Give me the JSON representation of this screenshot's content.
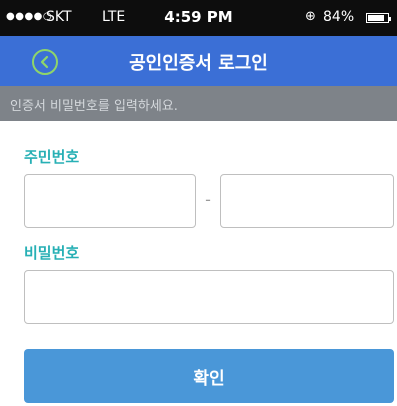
{
  "status_bar": {
    "signal": "●●●●○",
    "carrier": "SKT",
    "network": "LTE",
    "time": "4:59 PM",
    "battery_percent": "84%",
    "battery_level": 0.84
  },
  "header": {
    "back_icon": "chevron-left-circle-icon",
    "title": "공인인증서 로그인"
  },
  "notice": {
    "text": "인증서 비밀번호를 입력하세요."
  },
  "form": {
    "resident_label": "주민번호",
    "resident_front_value": "",
    "resident_back_value": "",
    "separator": "-",
    "password_label": "비밀번호",
    "password_value": ""
  },
  "actions": {
    "confirm_label": "확인"
  },
  "colors": {
    "nav_bar": "#3b6fd6",
    "back_icon_accent": "#8fd56a",
    "label_accent": "#27b0b5",
    "button": "#4a97d8",
    "notice_bar": "#7e8389"
  }
}
